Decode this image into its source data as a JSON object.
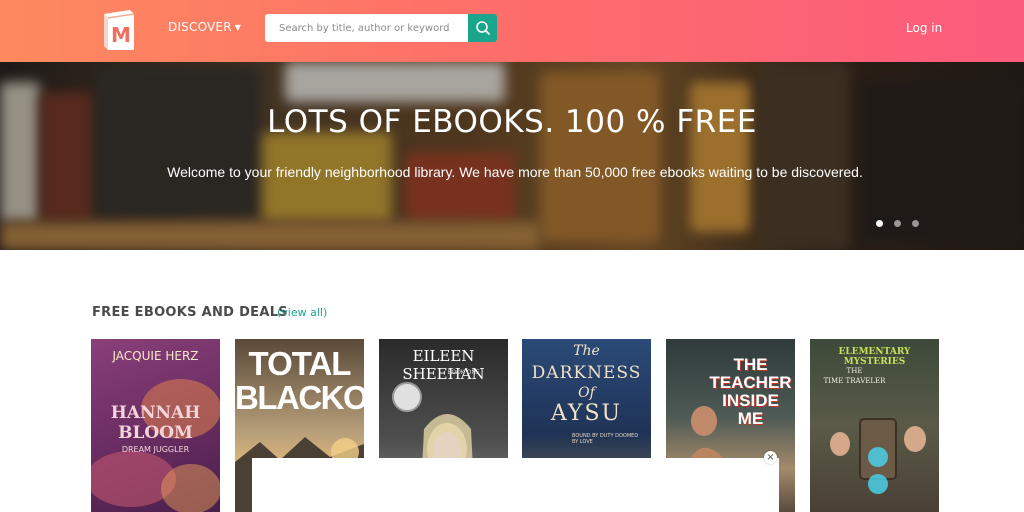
{
  "header": {
    "logo_letter": "M",
    "discover_label": "DISCOVER",
    "search_placeholder": "Search by title, author or keyword",
    "login_label": "Log in"
  },
  "hero": {
    "title": "LOTS OF EBOOKS. 100 % FREE",
    "subtitle": "Welcome to your friendly neighborhood library. We have more than 50,000 free ebooks waiting to be discovered.",
    "slides": 3,
    "active_slide": 1
  },
  "section": {
    "title": "FREE EBOOKS AND DEALS",
    "view_all": "(view all)"
  },
  "books": [
    {
      "author": "JACQUIE HERZ",
      "title_line1": "HANNAH",
      "title_line2": "BLOOM",
      "tagline": "DREAM JUGGLER"
    },
    {
      "title_line1": "TOTAL",
      "title_line2": "BLACKOUT"
    },
    {
      "author": "EILEEN SHEEHAN",
      "series": "BOOK ONE"
    },
    {
      "title_line1": "The",
      "title_line2": "DARKNESS",
      "title_line3": "Of",
      "title_line4": "AYSU",
      "tagline": "BOUND BY DUTY DOOMED BY LOVE"
    },
    {
      "title_line1": "THE",
      "title_line2": "TEACHER",
      "title_line3": "INSIDE",
      "title_line4": "ME"
    },
    {
      "series": "ELEMENTARY MYSTERIES",
      "title_line1": "THE",
      "title_line2": "TIME TRAVELER"
    }
  ],
  "ad": {
    "close": "×"
  },
  "colors": {
    "accent": "#1aa58d",
    "header_start": "#fd8a5e",
    "header_end": "#fb5b7c"
  }
}
